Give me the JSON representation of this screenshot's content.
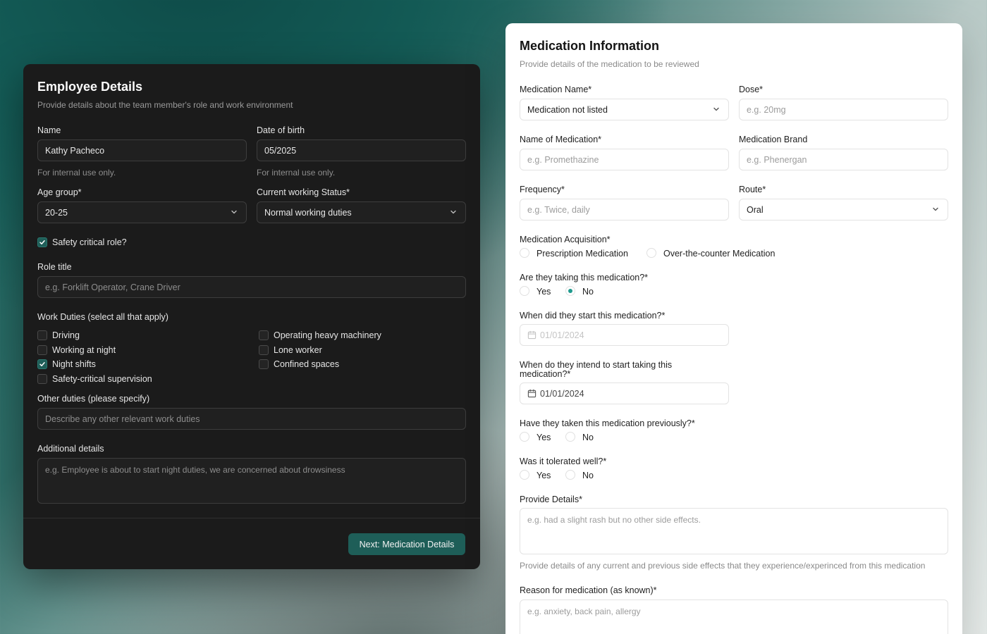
{
  "employee": {
    "title": "Employee Details",
    "subtitle": "Provide details about the team member's role and work environment",
    "name_label": "Name",
    "name_value": "Kathy Pacheco",
    "name_hint": "For internal use only.",
    "dob_label": "Date of birth",
    "dob_value": "05/2025",
    "dob_hint": "For internal use only.",
    "age_label": "Age group*",
    "age_value": "20-25",
    "status_label": "Current working Status*",
    "status_value": "Normal working duties",
    "safety_label": "Safety critical role?",
    "safety_checked": true,
    "role_label": "Role title",
    "role_placeholder": "e.g. Forklift Operator, Crane Driver",
    "duties_label": "Work Duties (select all that apply)",
    "duties": [
      {
        "label": "Driving",
        "checked": false
      },
      {
        "label": "Working at night",
        "checked": false
      },
      {
        "label": "Night shifts",
        "checked": true
      },
      {
        "label": "Safety-critical supervision",
        "checked": false
      },
      {
        "label": "Operating heavy machinery",
        "checked": false
      },
      {
        "label": "Lone worker",
        "checked": false
      },
      {
        "label": "Confined spaces",
        "checked": false
      }
    ],
    "other_label": "Other duties (please specify)",
    "other_placeholder": "Describe any other relevant work duties",
    "additional_label": "Additional details",
    "additional_placeholder": "e.g. Employee is about to start night duties, we are concerned about drowsiness",
    "next_button": "Next: Medication Details"
  },
  "medication": {
    "title": "Medication Information",
    "subtitle": "Provide details of the medication to be reviewed",
    "med_name_label": "Medication Name*",
    "med_name_value": "Medication not listed",
    "dose_label": "Dose*",
    "dose_placeholder": "e.g. 20mg",
    "name_of_med_label": "Name of Medication*",
    "name_of_med_placeholder": "e.g. Promethazine",
    "brand_label": "Medication Brand",
    "brand_placeholder": "e.g. Phenergan",
    "frequency_label": "Frequency*",
    "frequency_placeholder": "e.g. Twice, daily",
    "route_label": "Route*",
    "route_value": "Oral",
    "acquisition_label": "Medication Acquisition*",
    "acq_option1": "Prescription Medication",
    "acq_option2": "Over-the-counter Medication",
    "taking_label": "Are they taking this medication?*",
    "taking_selected": "No",
    "yes": "Yes",
    "no": "No",
    "start_label": "When did they start this medication?*",
    "start_value": "01/01/2024",
    "intend_label": "When do they intend to start taking this medication?*",
    "intend_value": "01/01/2024",
    "previous_label": "Have they taken this medication previously?*",
    "tolerated_label": "Was it tolerated well?*",
    "details_label": "Provide Details*",
    "details_placeholder": "e.g. had a slight rash but no other side effects.",
    "details_hint": "Provide details of any current and previous side effects that they experience/experinced from this medication",
    "reason_label": "Reason for medication (as known)*",
    "reason_placeholder": "e.g. anxiety, back pain, allergy"
  },
  "colors": {
    "accent": "#1f5e58",
    "radio_selected": "#1f9a8e",
    "dark_card": "#1b1b1b"
  }
}
